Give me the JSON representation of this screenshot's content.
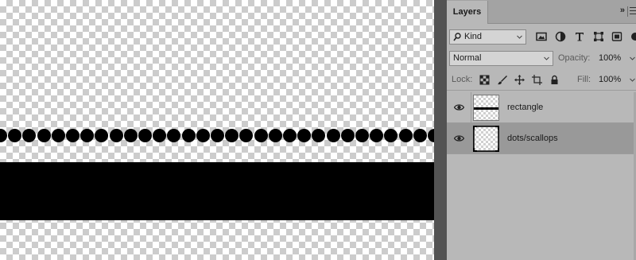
{
  "canvas": {
    "background": "transparent-checkerboard",
    "dots_layer_color": "#000000",
    "rectangle_layer_color": "#000000",
    "dot_count": 31
  },
  "layers_panel": {
    "tab_label": "Layers",
    "collapse_icon": "double-chevron-right-icon",
    "menu_icon": "hamburger-menu-icon",
    "filter": {
      "search_icon": "magnifier-icon",
      "kind_label": "Kind",
      "filter_icons": [
        "image-filter-icon",
        "adjustment-filter-icon",
        "type-filter-icon",
        "shape-filter-icon",
        "smart-object-filter-icon"
      ]
    },
    "blend": {
      "mode": "Normal",
      "opacity_label": "Opacity:",
      "opacity_value": "100%"
    },
    "lock": {
      "label": "Lock:",
      "icons": [
        "lock-transparent-pixels-icon",
        "lock-image-pixels-icon",
        "lock-position-icon",
        "lock-artboard-icon",
        "lock-all-icon"
      ],
      "fill_label": "Fill:",
      "fill_value": "100%"
    },
    "layers": [
      {
        "name": "rectangle",
        "visible": true,
        "selected": false
      },
      {
        "name": "dots/scallops",
        "visible": true,
        "selected": true
      }
    ],
    "colors": {
      "panel_bg": "#b8b8b8",
      "selected_row": "#999999",
      "workspace": "#535353"
    }
  }
}
